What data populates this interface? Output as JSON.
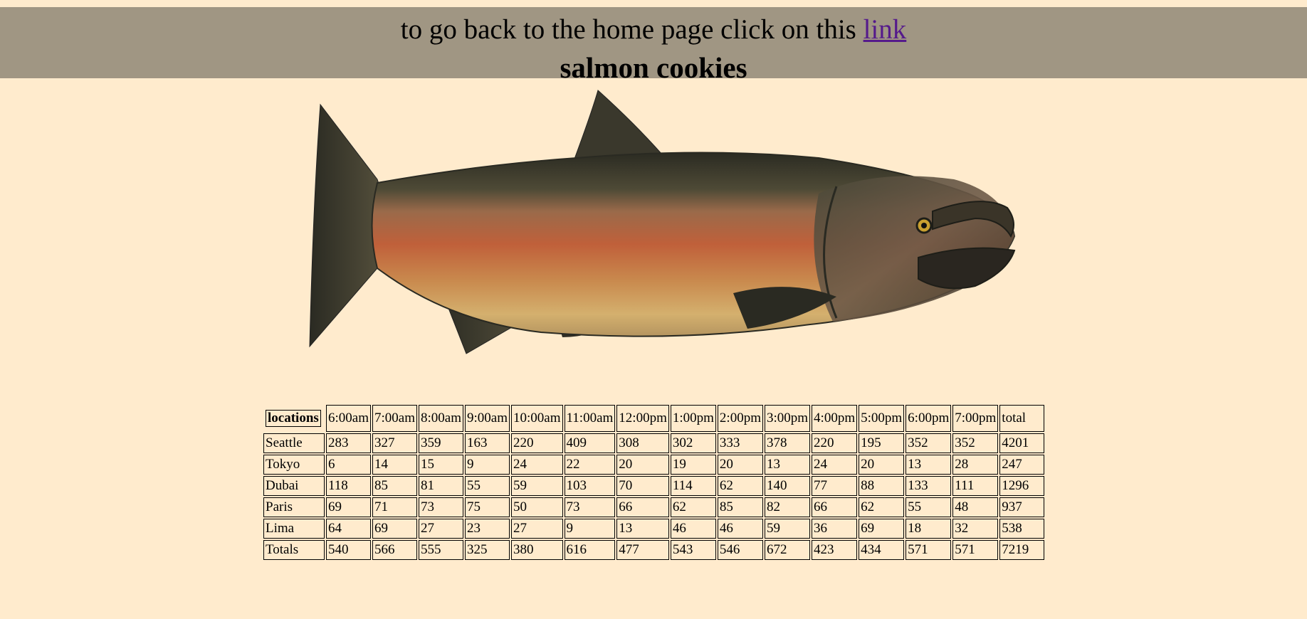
{
  "header": {
    "nav_text": "to go back to the home page click on this ",
    "nav_link": "link",
    "title": "salmon cookies"
  },
  "image": {
    "subject": "salmon-fish-illustration"
  },
  "colors": {
    "page_background": "#ffebcd",
    "header_background": "#a09683",
    "link": "#551a8b"
  },
  "table": {
    "corner_header": "locations",
    "columns": [
      "6:00am",
      "7:00am",
      "8:00am",
      "9:00am",
      "10:00am",
      "11:00am",
      "12:00pm",
      "1:00pm",
      "2:00pm",
      "3:00pm",
      "4:00pm",
      "5:00pm",
      "6:00pm",
      "7:00pm",
      "total"
    ],
    "rows": [
      {
        "location": "Seattle",
        "values": [
          "283",
          "327",
          "359",
          "163",
          "220",
          "409",
          "308",
          "302",
          "333",
          "378",
          "220",
          "195",
          "352",
          "352",
          "4201"
        ]
      },
      {
        "location": "Tokyo",
        "values": [
          "6",
          "14",
          "15",
          "9",
          "24",
          "22",
          "20",
          "19",
          "20",
          "13",
          "24",
          "20",
          "13",
          "28",
          "247"
        ]
      },
      {
        "location": "Dubai",
        "values": [
          "118",
          "85",
          "81",
          "55",
          "59",
          "103",
          "70",
          "114",
          "62",
          "140",
          "77",
          "88",
          "133",
          "111",
          "1296"
        ]
      },
      {
        "location": "Paris",
        "values": [
          "69",
          "71",
          "73",
          "75",
          "50",
          "73",
          "66",
          "62",
          "85",
          "82",
          "66",
          "62",
          "55",
          "48",
          "937"
        ]
      },
      {
        "location": "Lima",
        "values": [
          "64",
          "69",
          "27",
          "23",
          "27",
          "9",
          "13",
          "46",
          "46",
          "59",
          "36",
          "69",
          "18",
          "32",
          "538"
        ]
      }
    ],
    "totals": {
      "location": "Totals",
      "values": [
        "540",
        "566",
        "555",
        "325",
        "380",
        "616",
        "477",
        "543",
        "546",
        "672",
        "423",
        "434",
        "571",
        "571",
        "7219"
      ]
    }
  }
}
